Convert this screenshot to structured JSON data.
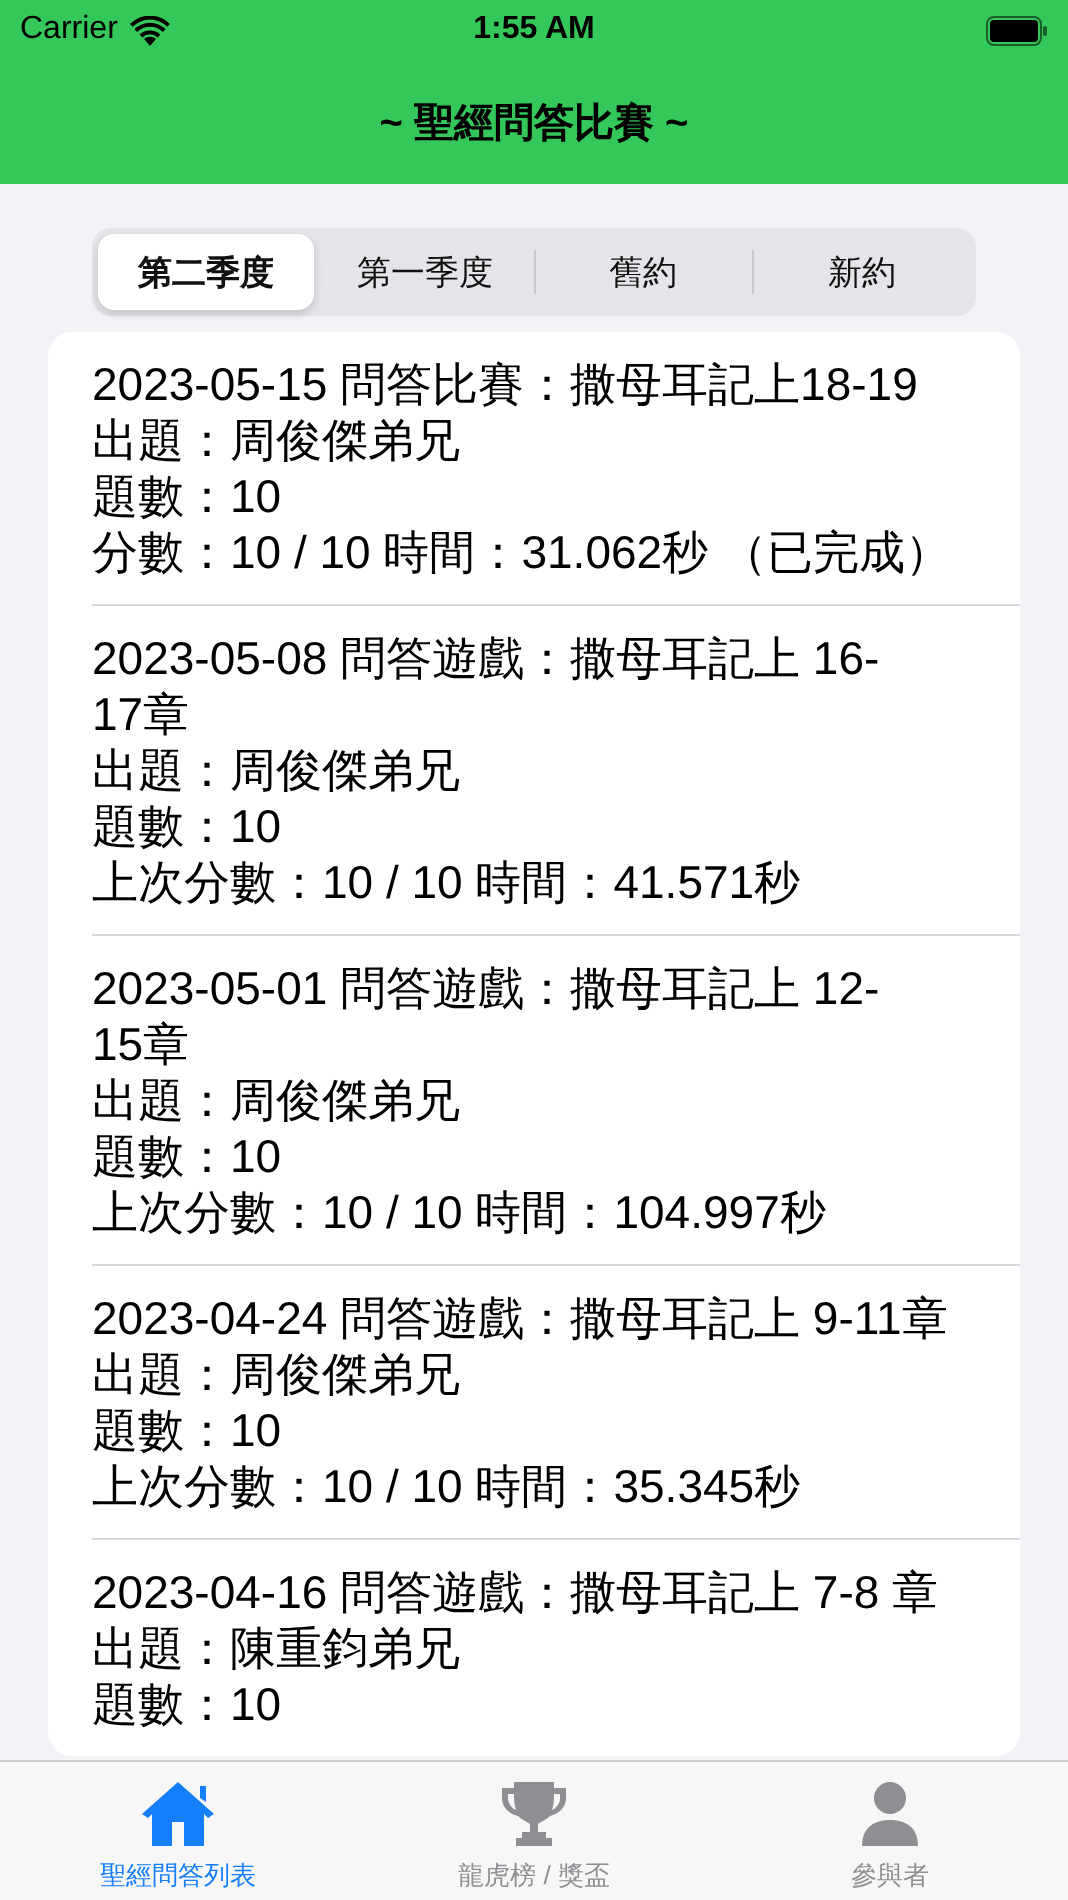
{
  "status_bar": {
    "carrier": "Carrier",
    "time": "1:55 AM"
  },
  "nav": {
    "title": "~ 聖經問答比賽 ~"
  },
  "segments": [
    {
      "label": "第二季度",
      "selected": true
    },
    {
      "label": "第一季度",
      "selected": false
    },
    {
      "label": "舊約",
      "selected": false
    },
    {
      "label": "新約",
      "selected": false
    }
  ],
  "quizzes": [
    {
      "title": "2023-05-15 問答比賽：撒母耳記上18-19",
      "host": "出題：周俊傑弟兄",
      "count": "題數：10",
      "score": "分數：10 / 10 時間：31.062秒 （已完成）"
    },
    {
      "title": "2023-05-08 問答遊戲：撒母耳記上 16-17章",
      "host": "出題：周俊傑弟兄",
      "count": "題數：10",
      "score": "上次分數：10 / 10 時間：41.571秒"
    },
    {
      "title": "2023-05-01 問答遊戲：撒母耳記上 12-15章",
      "host": "出題：周俊傑弟兄",
      "count": "題數：10",
      "score": "上次分數：10 / 10 時間：104.997秒"
    },
    {
      "title": "2023-04-24 問答遊戲：撒母耳記上 9-11章",
      "host": "出題：周俊傑弟兄",
      "count": "題數：10",
      "score": "上次分數：10 / 10 時間：35.345秒"
    },
    {
      "title": "2023-04-16 問答遊戲：撒母耳記上 7-8 章",
      "host": "出題：陳重鈞弟兄",
      "count": "題數：10"
    }
  ],
  "tabs": [
    {
      "label": "聖經問答列表",
      "selected": true
    },
    {
      "label": "龍虎榜 / 獎盃",
      "selected": false
    },
    {
      "label": "參與者",
      "selected": false
    }
  ]
}
